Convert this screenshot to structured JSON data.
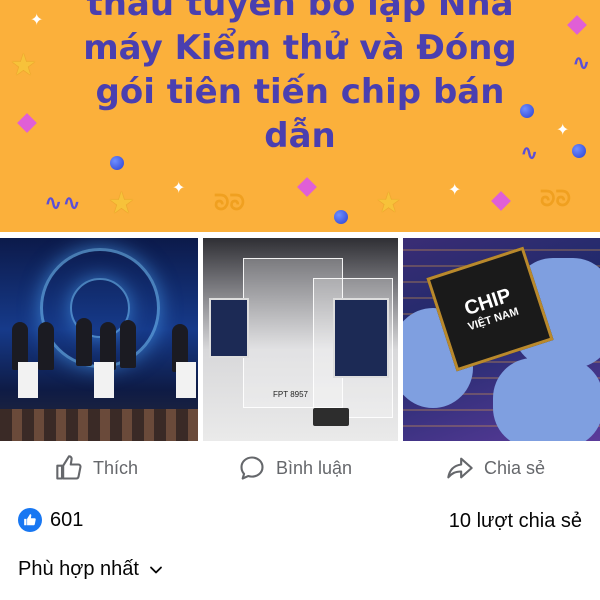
{
  "banner": {
    "lines": [
      "thầu tuyển bố lập Nhà",
      "máy Kiểm thử và Đóng",
      "gói tiên tiến chip bán",
      "dẫn"
    ]
  },
  "photos": {
    "chip_label_line1": "CHIP",
    "chip_label_line2": "VIỆT NAM",
    "exhibit_label": "FPT 8957"
  },
  "actions": {
    "like_label": "Thích",
    "comment_label": "Bình luận",
    "share_label": "Chia sẻ"
  },
  "stats": {
    "like_count": "601",
    "share_count": "10 lượt chia sẻ"
  },
  "sort": {
    "label": "Phù hợp nhất"
  },
  "colors": {
    "banner_bg": "#fbb03b",
    "banner_text": "#4a3fb0",
    "like_blue": "#1877f2",
    "action_gray": "#65676b"
  }
}
